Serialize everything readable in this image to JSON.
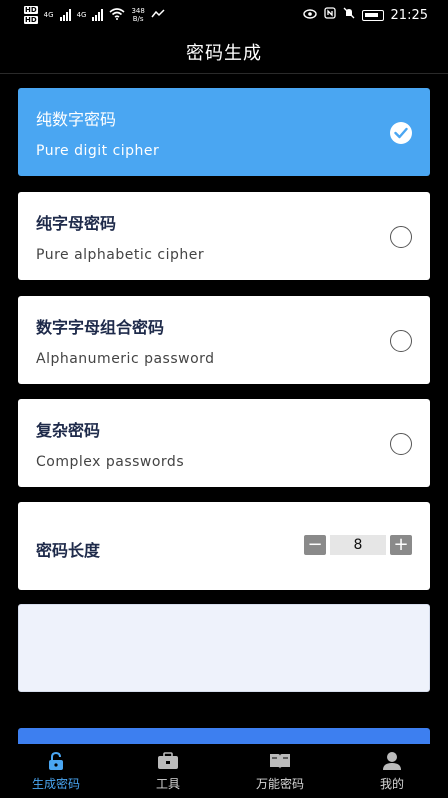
{
  "status_bar": {
    "hd1": "HD",
    "hd2": "HD",
    "net1": "4G",
    "net2": "4G",
    "speed_value": "348",
    "speed_unit": "B/s",
    "time": "21:25"
  },
  "header": {
    "title": "密码生成"
  },
  "options": [
    {
      "title": "纯数字密码",
      "subtitle": "Pure digit cipher",
      "selected": true
    },
    {
      "title": "纯字母密码",
      "subtitle": "Pure alphabetic cipher",
      "selected": false
    },
    {
      "title": "数字字母组合密码",
      "subtitle": "Alphanumeric password",
      "selected": false
    },
    {
      "title": "复杂密码",
      "subtitle": "Complex passwords",
      "selected": false
    }
  ],
  "length": {
    "label": "密码长度",
    "value": "8",
    "minus": "−",
    "plus": "+"
  },
  "output": {
    "text": ""
  },
  "tabs": [
    {
      "label": "生成密码",
      "icon": "lock-icon",
      "active": true
    },
    {
      "label": "工具",
      "icon": "toolbox-icon",
      "active": false
    },
    {
      "label": "万能密码",
      "icon": "book-icon",
      "active": false
    },
    {
      "label": "我的",
      "icon": "user-icon",
      "active": false
    }
  ],
  "colors": {
    "accent": "#4aa6f2",
    "button": "#3d7ff0",
    "background": "#000000"
  }
}
